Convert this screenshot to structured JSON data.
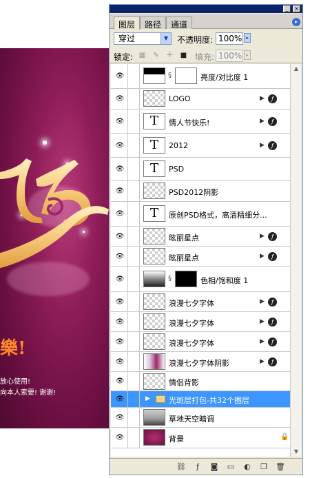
{
  "canvas": {
    "poster_char": "樂!",
    "poster_line1": "放心使用!",
    "poster_line2": "向本人索要! 谢谢!",
    "colors": {
      "bg_dark": "#6b0f42",
      "bg_mid": "#8d1d58",
      "glyph_gold": "#f6c878",
      "text_orange": "#ff8a2a"
    }
  },
  "panel": {
    "tabs": [
      {
        "label": "图层",
        "active": true
      },
      {
        "label": "路径",
        "active": false
      },
      {
        "label": "通道",
        "active": false
      }
    ],
    "menu_icon": "panel-menu-icon",
    "blend_mode": "穿过",
    "opacity_label": "不透明度:",
    "opacity_value": "100%",
    "lock_label": "锁定:",
    "fill_label": "填充:",
    "fill_value": "100%",
    "selected_color": "#3d95ff",
    "layers": [
      {
        "name": "亮度/对比度 1",
        "kind": "adjustment"
      },
      {
        "name": "LOGO",
        "kind": "pixel",
        "fx": true
      },
      {
        "name": "情人节快乐!",
        "kind": "text",
        "fx": true
      },
      {
        "name": "2012",
        "kind": "text",
        "fx": true
      },
      {
        "name": "PSD",
        "kind": "text"
      },
      {
        "name": "PSD2012阴影",
        "kind": "pixel"
      },
      {
        "name": "原创PSD格式，高清精细分...",
        "kind": "text"
      },
      {
        "name": "眩丽星点",
        "kind": "pixel",
        "fx": true
      },
      {
        "name": "眩丽星点",
        "kind": "pixel",
        "fx": true
      },
      {
        "name": "色相/饱和度 1",
        "kind": "hsl"
      },
      {
        "name": "浪漫七夕字体",
        "kind": "pixel",
        "fx": true
      },
      {
        "name": "浪漫七夕字体",
        "kind": "pixel",
        "fx": true
      },
      {
        "name": "浪漫七夕字体",
        "kind": "pixel",
        "fx": true
      },
      {
        "name": "浪漫七夕字体阴影",
        "kind": "pinkthumb",
        "fx": true
      },
      {
        "name": "情侣背影",
        "kind": "pixel"
      },
      {
        "name": "光斑层打包-共32个图层",
        "kind": "group",
        "selected": true
      },
      {
        "name": "草地天空暗调",
        "kind": "sky"
      },
      {
        "name": "背景",
        "kind": "background",
        "locked": true
      }
    ]
  }
}
